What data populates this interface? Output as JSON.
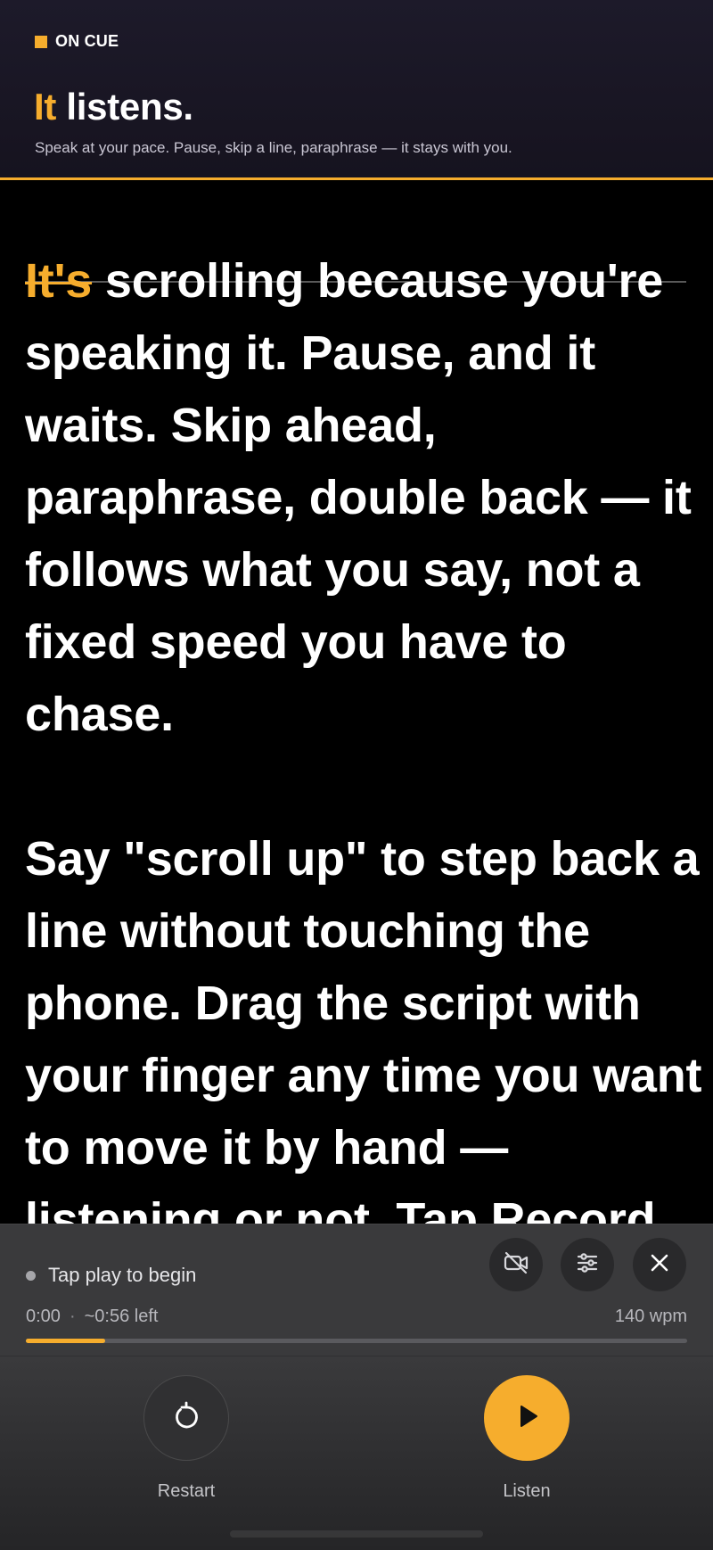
{
  "header": {
    "brand": "ON CUE",
    "title_accent": "It",
    "title_rest": " listens.",
    "subtitle": "Speak at your pace. Pause, skip a line, paraphrase — it stays with you."
  },
  "script": {
    "spoken_word": "It's",
    "paragraph1_rest": " scrolling because you're speaking it. Pause, and it waits. Skip ahead, paraphrase, double back — it follows what you say, not a fixed speed you have to chase.",
    "paragraph2": "Say \"scroll up\" to step back a line without touching the phone. Drag the script with your finger any time you want to move it by hand — listening or not. Tap Record"
  },
  "controls": {
    "status": "Tap play to begin",
    "elapsed": "0:00",
    "separator": "·",
    "remaining": "~0:56 left",
    "wpm": "140 wpm",
    "progress_percent": 12,
    "icons": [
      "camera-off-icon",
      "sliders-icon",
      "close-icon"
    ]
  },
  "transport": {
    "restart_label": "Restart",
    "listen_label": "Listen"
  },
  "colors": {
    "accent": "#f6ad2d",
    "background": "#000000",
    "panel": "#3c3c3e"
  }
}
